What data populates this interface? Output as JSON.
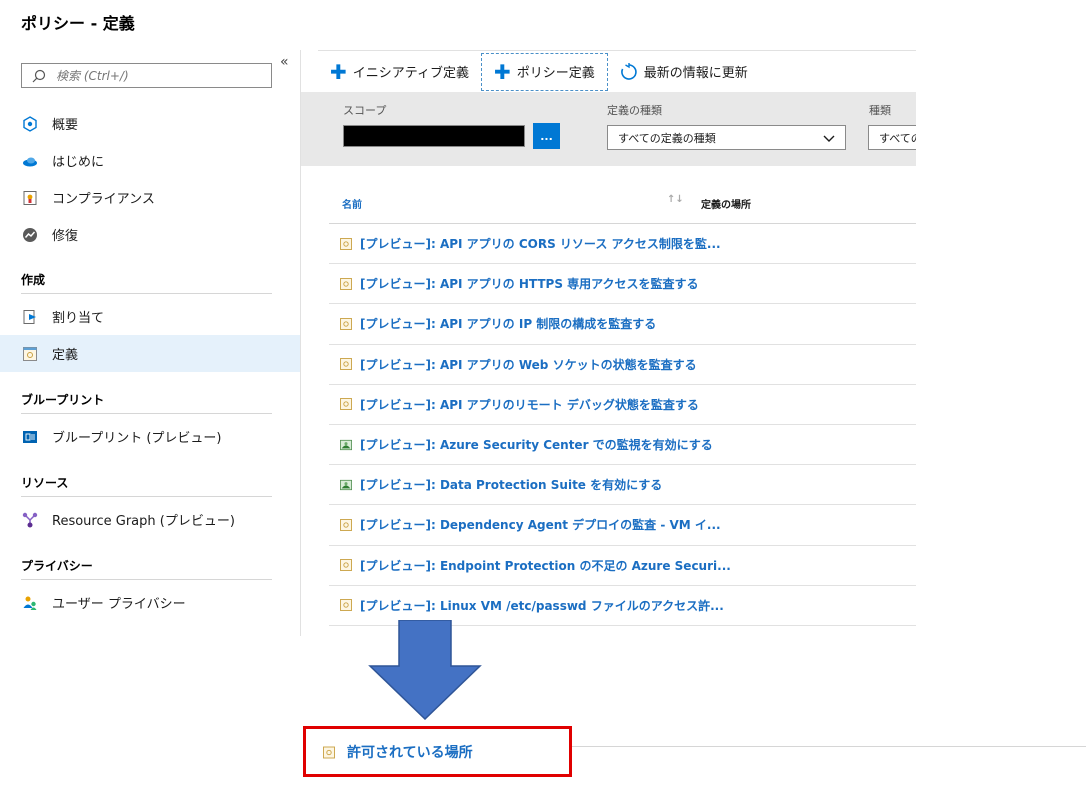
{
  "page_title": "ポリシー - 定義",
  "search": {
    "placeholder": "検索 (Ctrl+/)"
  },
  "nav": {
    "top_items": [
      {
        "label": "概要",
        "icon": "overview-icon"
      },
      {
        "label": "はじめに",
        "icon": "getting-started-icon"
      },
      {
        "label": "コンプライアンス",
        "icon": "compliance-icon"
      },
      {
        "label": "修復",
        "icon": "remediation-icon"
      }
    ],
    "sections": [
      {
        "header": "作成",
        "items": [
          {
            "label": "割り当て",
            "icon": "assignment-icon"
          },
          {
            "label": "定義",
            "icon": "definition-icon",
            "selected": true
          }
        ]
      },
      {
        "header": "ブループリント",
        "items": [
          {
            "label": "ブループリント (プレビュー)",
            "icon": "blueprint-icon"
          }
        ]
      },
      {
        "header": "リソース",
        "items": [
          {
            "label": "Resource Graph (プレビュー)",
            "icon": "resource-graph-icon"
          }
        ]
      },
      {
        "header": "プライバシー",
        "items": [
          {
            "label": "ユーザー プライバシー",
            "icon": "user-privacy-icon"
          }
        ]
      }
    ]
  },
  "toolbar": {
    "initiative_label": "イニシアティブ定義",
    "policy_label": "ポリシー定義",
    "refresh_label": "最新の情報に更新"
  },
  "filters": {
    "scope_label": "スコープ",
    "scope_button": "...",
    "definition_type_label": "定義の種類",
    "definition_type_value": "すべての定義の種類",
    "kind_label": "種類",
    "kind_value": "すべての"
  },
  "table": {
    "columns": [
      "名前",
      "定義の場所"
    ],
    "rows": [
      {
        "name": "[プレビュー]: API アプリの CORS リソース アクセス制限を監...",
        "icon": "policy-doc-icon"
      },
      {
        "name": "[プレビュー]: API アプリの HTTPS 専用アクセスを監査する",
        "icon": "policy-doc-icon"
      },
      {
        "name": "[プレビュー]: API アプリの IP 制限の構成を監査する",
        "icon": "policy-doc-icon"
      },
      {
        "name": "[プレビュー]: API アプリの Web ソケットの状態を監査する",
        "icon": "policy-doc-icon"
      },
      {
        "name": "[プレビュー]: API アプリのリモート デバッグ状態を監査する",
        "icon": "policy-doc-icon"
      },
      {
        "name": "[プレビュー]: Azure Security Center での監視を有効にする",
        "icon": "initiative-icon"
      },
      {
        "name": "[プレビュー]: Data Protection Suite を有効にする",
        "icon": "initiative-icon"
      },
      {
        "name": "[プレビュー]: Dependency Agent デプロイの監査 - VM イ...",
        "icon": "policy-doc-icon"
      },
      {
        "name": "[プレビュー]: Endpoint Protection の不足の Azure Securi...",
        "icon": "policy-doc-icon"
      },
      {
        "name": "[プレビュー]: Linux VM /etc/passwd ファイルのアクセス許...",
        "icon": "policy-doc-icon"
      }
    ]
  },
  "result": {
    "label": "許可されている場所",
    "icon": "policy-doc-icon"
  },
  "colors": {
    "accent": "#0078d4",
    "link": "#1b6ec2",
    "highlight": "#e00000",
    "arrow": "#4472c4"
  }
}
